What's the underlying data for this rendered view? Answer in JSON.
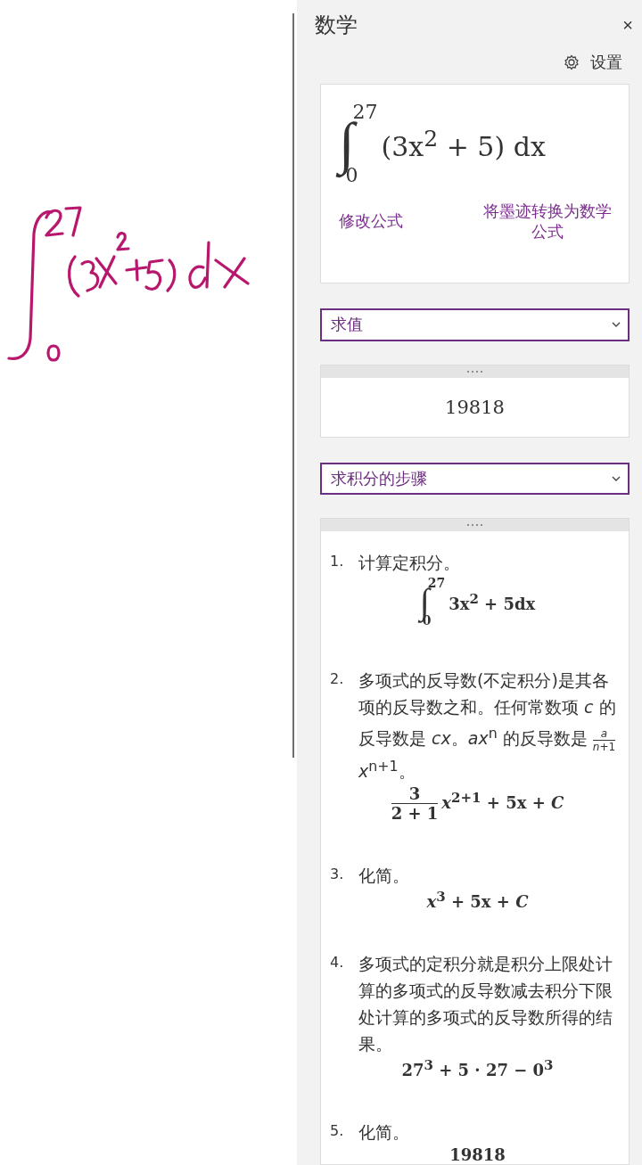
{
  "pane": {
    "title": "数学",
    "close": "×",
    "settings": "设置"
  },
  "equation": {
    "sign": "∫",
    "lower": "0",
    "upper": "27",
    "body": "(3x$^{2}$ + 5) dx",
    "edit_link": "修改公式",
    "convert_link": "将墨迹转换为数学公式"
  },
  "action_select": {
    "value": "求值"
  },
  "result": {
    "value": "19818"
  },
  "steps_select": {
    "value": "求积分的步骤"
  },
  "steps": [
    {
      "number": "1.",
      "text": [
        {
          "text": "计算定积分。"
        }
      ],
      "formula": {
        "kind": "integral",
        "sign": "∫",
        "lower": "0",
        "upper": "27",
        "body": "3x$^{2}$ + 5dx"
      }
    },
    {
      "number": "2.",
      "text": [
        {
          "text": "多项式的反导数(不定积分)是其各项的反导数之和。任何常数项 *c* 的反导数是 *cx*。*ax*$^{n}$ 的反导数是 "
        },
        {
          "num": "*a*",
          "den": "*n*+1"
        },
        {
          "text": "*x*$^{n+1}$。"
        }
      ],
      "formula": {
        "kind": "fraction",
        "num": "3",
        "den": "2 + 1",
        "tail": "*x*$^{2+1}$ + 5x + *C*"
      }
    },
    {
      "number": "3.",
      "text": [
        {
          "text": "化简。"
        }
      ],
      "formula": {
        "kind": "plain",
        "body": "*x*$^{3}$ + 5x + *C*"
      }
    },
    {
      "number": "4.",
      "text": [
        {
          "text": "多项式的定积分就是积分上限处计算的多项式的反导数减去积分下限处计算的多项式的反导数所得的结果。"
        }
      ],
      "formula": {
        "kind": "plain",
        "body": "27$^{3}$ + 5 · 27 − 0$^{3}$"
      }
    },
    {
      "number": "5.",
      "text": [
        {
          "text": "化简。"
        }
      ],
      "formula": {
        "kind": "plain",
        "body": "19818"
      }
    }
  ]
}
